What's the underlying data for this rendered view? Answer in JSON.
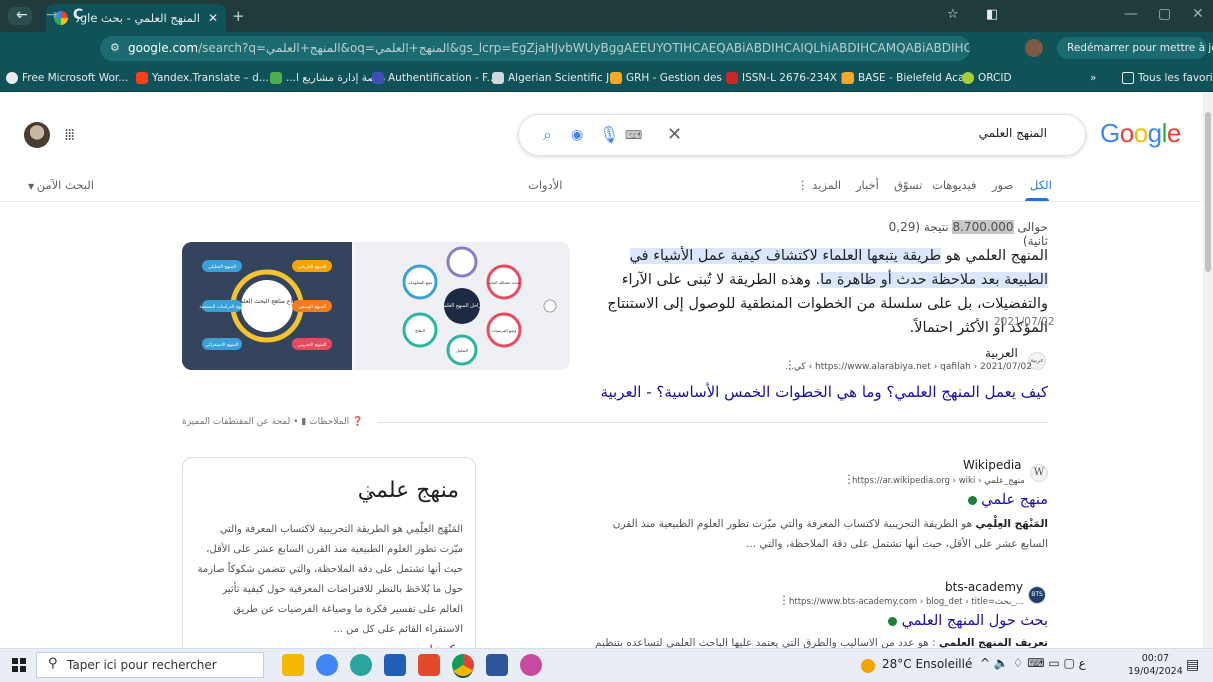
{
  "browser": {
    "tab_menu_icon": "chevron-down",
    "tab_title": "المنهج العلمي - بحث Google",
    "tab_close": "✕",
    "new_tab": "+",
    "window_controls": [
      "—",
      "▢",
      "✕"
    ],
    "back": "←",
    "forward": "→",
    "reload": "C",
    "url_host": "google.com",
    "url_rest": "/search?q=المنهج+العلمي&oq=المنهج+العلمي&gs_lcrp=EgZjaHJvbWUyBggAEEUYOTIHCAEQABiABDIHCAIQLhiABDIHCAMQABiABDIHCAQQABiABDIHCA...",
    "restart_label": "Redémarrer pour mettre à jour",
    "bookmarks": [
      {
        "label": "Free Microsoft Wor...",
        "color": "#e8eaed"
      },
      {
        "label": "Yandex.Translate – d...",
        "color": "#fc3f1d"
      },
      {
        "label": "منصة إدارة مشاريع ا...",
        "color": "#4caf50"
      },
      {
        "label": "Authentification - F...",
        "color": "#3f51b5"
      },
      {
        "label": "Algerian Scientific J...",
        "color": "#cfd8dc"
      },
      {
        "label": "GRH - Gestion des r...",
        "color": "#f9a825"
      },
      {
        "label": "ISSN-L 2676-234X |...",
        "color": "#c62828"
      },
      {
        "label": "BASE - Bielefeld Aca...",
        "color": "#f9a825"
      },
      {
        "label": "ORCID",
        "color": "#a6ce39"
      }
    ],
    "bookmarks_more": "»",
    "all_bookmarks": "Tous les favoris"
  },
  "google": {
    "logo": "Google",
    "query": "المنهج العلمي",
    "tabs": {
      "all": "الكل",
      "images": "صور",
      "videos": "فيديوهات",
      "shopping": "تسوّق",
      "news": "أخبار",
      "more": "المزيد",
      "tools": "الأدوات",
      "safe_search": "البحث الآمن"
    },
    "stats_prefix": "حوالى",
    "stats_count": "8.700.000",
    "stats_suffix": "نتيجة (0,29 ثانية)",
    "featured": {
      "snippet_a": "المنهج العلمي هو ",
      "snippet_hl": "طريقة يتبعها العلماء لاكتشاف كيفية عمل الأشياء في الطبيعة بعد ملاحظة حدث أو ظاهرة ما",
      "snippet_b": ". وهذه الطريقة لا تُبنى على الآراء والتفضيلات، بل على سلسلة من الخطوات المنطقية للوصول إلى الاستنتاج المؤكد أو الأكثر احتمالاً.",
      "date": "2021/07/02",
      "source_name": "العربية",
      "source_url": "https://www.alarabiya.net › qafilah › 2021/07/02 › كي...",
      "title": "كيف يعمل المنهج العلمي؟ وما هي الخطوات الخمس الأساسية؟ - العربية",
      "about": "لمحة عن المقتطفات المميزة",
      "feedback": "الملاحظات",
      "img1_labels": [
        "أنواع مناهج البحث العلمي",
        "المنهج التاريخي",
        "المنهج الوصفي",
        "المنهج التجريبي",
        "المنهج التحليلي",
        "منهج الدراسات المسحية",
        "المنهج الاستقرائي"
      ],
      "img2_labels": [
        "مراحل المنهج العلمي",
        "تحديد مشكلة البحث",
        "وضع الفرضيات",
        "جمع المعلومات",
        "النتائج",
        "التحليل"
      ]
    },
    "knowledge_panel": {
      "title": "منهج علمي",
      "description": "المَنْهَج العِلْمِي هو الطريقة التجريبية لاكتساب المعرفة والتي ميّزت تطور العلوم الطبيعية منذ القرن السابع عشر على الأقل، حيث أنها تشتمل على دقة الملاحظة، والتي تتضمن شكوكاً صارمة حول ما يُلاحَظ بالنظر للافتراضات المعرفية حول كيفية تأثير العالم على تفسير فكرة ما وصياغة الفرضيات عن طريق الاستقراء القائم على كل من ...",
      "link": "ويكيبيديا"
    },
    "results": [
      {
        "name": "Wikipedia",
        "favicon": "W",
        "url": "https://ar.wikipedia.org › wiki › منهج_علمي",
        "title": "منهج علمي",
        "snippet_bold": "المَنْهَج العِلْمِي",
        "snippet": " هو الطريقة التجريبية لاكتساب المعرفة والتي ميّزت تطور العلوم الطبيعية منذ القرن السابع عشر على الأقل، حيث أنها تشتمل على دقة الملاحظة، والتي ..."
      },
      {
        "name": "bts-academy",
        "favicon": "BTS",
        "url": "https://www.bts-academy.com › blog_det › title=بحث_...",
        "title": "بحث حول المنهج العلمي",
        "snippet_bold": "تعريف المنهج العلمي",
        "snippet": " : هو عدد من الاساليب والطرق التي يعتمد عليها الباحث العلمي لتساعده بتنظيم وتنسيق"
      }
    ]
  },
  "taskbar": {
    "search_placeholder": "Taper ici pour rechercher",
    "weather": "28°C  Ensoleillé",
    "tray": "^  🔈  ♢  ⌨  ▭  ▢  ع",
    "time": "00:07",
    "date": "19/04/2024",
    "apps": [
      {
        "name": "file-explorer",
        "color": "#f2b900"
      },
      {
        "name": "chrome-canary",
        "color": "#4285f4"
      },
      {
        "name": "edge",
        "color": "#2aa4a0"
      },
      {
        "name": "store",
        "color": "#1f5fb5"
      },
      {
        "name": "adobe",
        "color": "#e24a2a"
      },
      {
        "name": "chrome",
        "color": "#db4437"
      },
      {
        "name": "word",
        "color": "#2b579a"
      },
      {
        "name": "paint",
        "color": "#c84aa0"
      }
    ]
  }
}
